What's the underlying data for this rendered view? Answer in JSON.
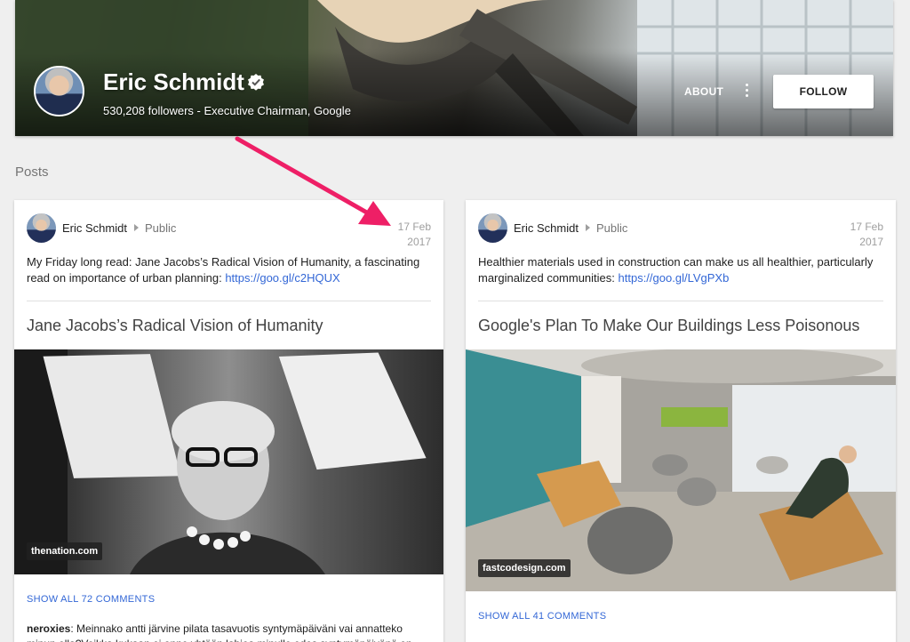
{
  "profile": {
    "name": "Eric Schmidt",
    "subtitle": "530,208 followers - Executive Chairman, Google",
    "about_label": "ABOUT",
    "follow_label": "FOLLOW"
  },
  "section_title": "Posts",
  "posts": [
    {
      "author": "Eric Schmidt",
      "visibility": "Public",
      "date_line1": "17 Feb",
      "date_line2": "2017",
      "text": "My Friday long read: Jane Jacobs’s Radical Vision of Humanity, a fascinating read on importance of urban planning: ",
      "url": "https://goo.gl/c2HQUX",
      "link_title": "Jane Jacobs’s Radical Vision of Humanity",
      "source": "thenation.com",
      "comments_label": "SHOW ALL 72 COMMENTS",
      "comment_author": "neroxies",
      "comment_text": ": Meinnako antti järvine pilata tasavuotis syntymäpäiväni vai annatteko minun olla?Voikka kukaan ei onne yhtään lahjoa minulle edes syntymäpäivänä en koinaa"
    },
    {
      "author": "Eric Schmidt",
      "visibility": "Public",
      "date_line1": "17 Feb",
      "date_line2": "2017",
      "text": "Healthier materials used in construction can make us all healthier, particularly marginalized communities: ",
      "url": "https://goo.gl/LVgPXb",
      "link_title": "Google's Plan To Make Our Buildings Less Poisonous",
      "source": "fastcodesign.com",
      "comments_label": "SHOW ALL 41 COMMENTS"
    }
  ],
  "colors": {
    "link": "#3367d6",
    "annotation_arrow": "#ee1f66"
  },
  "icons": [
    "verified-icon",
    "more-vert-icon",
    "chevron-right-icon"
  ]
}
